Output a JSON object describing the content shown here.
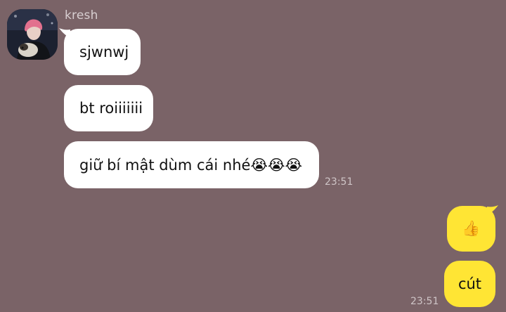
{
  "conversation": {
    "sender": {
      "name": "kresh"
    },
    "incoming": [
      {
        "text": "sjwnwj"
      },
      {
        "text": "bt roiiiiiii"
      },
      {
        "text": "giữ bí mật dùm cái nhé😭😭😭",
        "time": "23:51"
      }
    ],
    "outgoing": [
      {
        "text": "👍"
      },
      {
        "text": "cút",
        "time": "23:51"
      }
    ]
  },
  "colors": {
    "background": "#7a6367",
    "incoming_bubble": "#ffffff",
    "outgoing_bubble": "#ffe534",
    "timestamp": "#cfc5c7",
    "sender_name": "#d8cfd1"
  }
}
